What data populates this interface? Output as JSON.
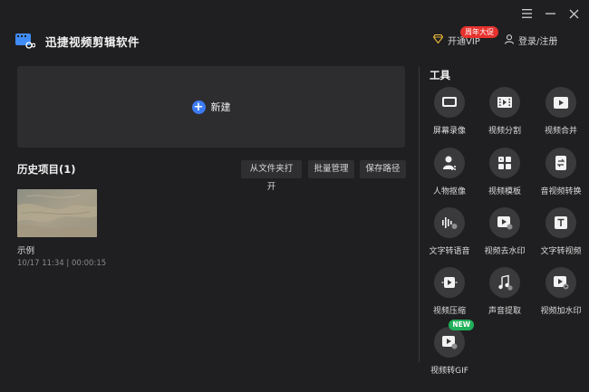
{
  "window": {
    "menu_icon": "menu-icon",
    "minimize_icon": "minimize-icon",
    "close_icon": "close-icon"
  },
  "header": {
    "app_title": "迅捷视频剪辑软件",
    "vip_label": "开通VIP",
    "vip_badge": "周年大促",
    "login_label": "登录/注册"
  },
  "new_project": {
    "label": "新建"
  },
  "history": {
    "title": "历史项目(1)",
    "buttons": [
      "从文件夹打开",
      "批量管理",
      "保存路径"
    ],
    "items": [
      {
        "name": "示例",
        "meta": "10/17 11:34 | 00:00:15"
      }
    ]
  },
  "tools": {
    "title": "工具",
    "items": [
      {
        "label": "屏幕录像",
        "icon": "screen-record-icon"
      },
      {
        "label": "视频分割",
        "icon": "video-split-icon"
      },
      {
        "label": "视频合并",
        "icon": "video-merge-icon"
      },
      {
        "label": "人物抠像",
        "icon": "portrait-cutout-icon"
      },
      {
        "label": "视频模板",
        "icon": "video-template-icon"
      },
      {
        "label": "音视频转换",
        "icon": "av-convert-icon"
      },
      {
        "label": "文字转语音",
        "icon": "text-to-speech-icon"
      },
      {
        "label": "视频去水印",
        "icon": "remove-watermark-icon"
      },
      {
        "label": "文字转视频",
        "icon": "text-to-video-icon"
      },
      {
        "label": "视频压缩",
        "icon": "video-compress-icon"
      },
      {
        "label": "声音提取",
        "icon": "audio-extract-icon"
      },
      {
        "label": "视频加水印",
        "icon": "add-watermark-icon"
      },
      {
        "label": "视频转GIF",
        "icon": "video-to-gif-icon",
        "badge": "NEW"
      }
    ]
  },
  "colors": {
    "background": "#1f1f21",
    "panel": "#2d2d30",
    "accent_blue": "#3d7bf5",
    "badge_red": "#e5322d",
    "badge_green": "#20b05a",
    "vip_gold": "#f0b93a"
  }
}
